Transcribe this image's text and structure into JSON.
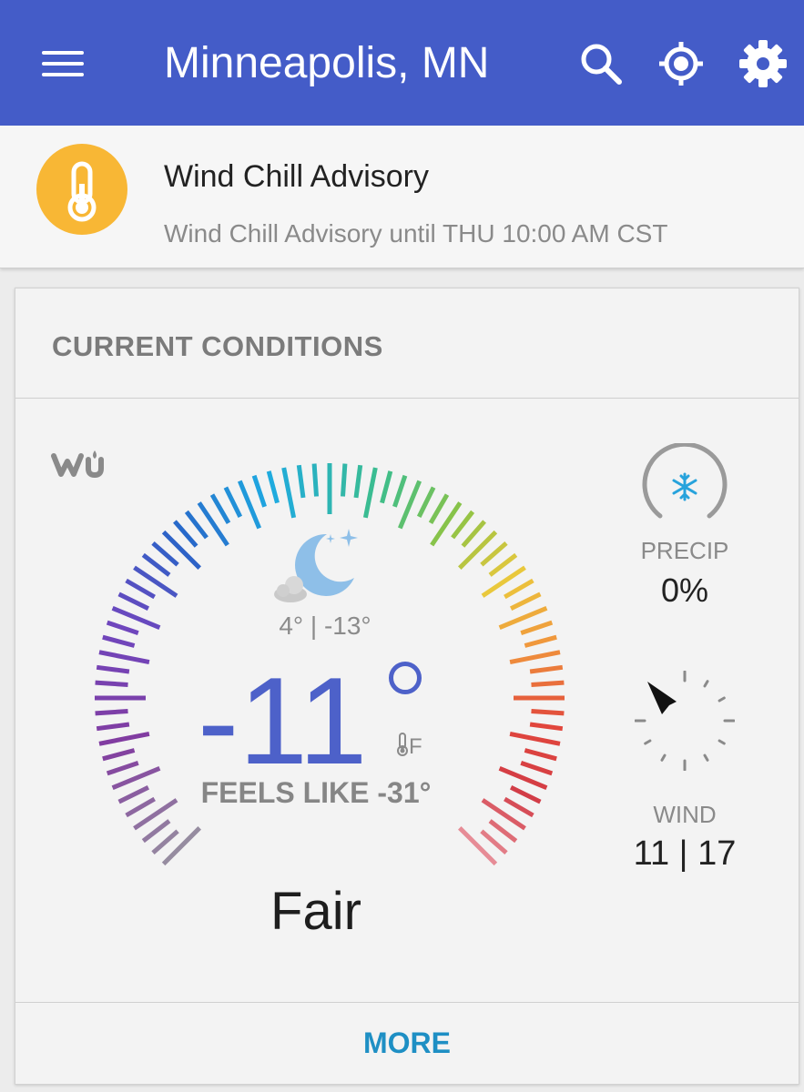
{
  "app_bar": {
    "title": "Minneapolis, MN",
    "menu_icon": "menu-icon",
    "search_icon": "search-icon",
    "location_icon": "gps-location-icon",
    "settings_icon": "gear-icon",
    "color": "#445cc8"
  },
  "advisory": {
    "icon": "thermometer-icon",
    "icon_color": "#f8b735",
    "title": "Wind Chill Advisory",
    "subtitle": "Wind Chill Advisory until THU 10:00 AM CST"
  },
  "current_conditions": {
    "header": "CURRENT CONDITIONS",
    "logo": "wu-logo",
    "weather_icon": "moon-with-cloud-icon",
    "hi_lo": "4° | -13°",
    "temperature": "-11",
    "unit": "F",
    "feels_like": "FEELS LIKE -31°",
    "condition": "Fair",
    "precip": {
      "label": "PRECIP",
      "value": "0%",
      "icon": "snowflake-icon"
    },
    "wind": {
      "label": "WIND",
      "value": "11 | 17",
      "icon": "wind-direction-arrow-icon"
    },
    "more_label": "MORE"
  }
}
